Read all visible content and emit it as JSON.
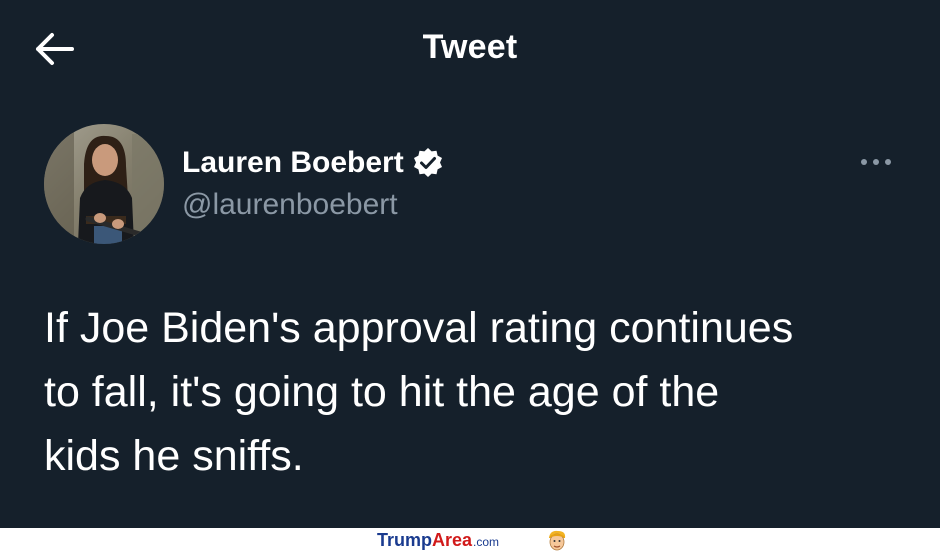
{
  "header": {
    "back_icon": "arrow-left-icon",
    "title": "Tweet"
  },
  "tweet": {
    "author": {
      "display_name": "Lauren Boebert",
      "verified": true,
      "verified_icon": "verified-badge-icon",
      "handle": "@laurenboebert"
    },
    "more_icon": "more-options-icon",
    "text": "If Joe Biden's approval rating continues\nto fall, it's going to hit the age of the\nkids he sniffs."
  },
  "watermark": {
    "brand_part1": "Trump",
    "brand_part2": "Area",
    "brand_suffix": ".com",
    "mascot_icon": "cartoon-face-icon"
  },
  "colors": {
    "background": "#15202b",
    "text_primary": "#ffffff",
    "text_secondary": "#8b98a5",
    "verified_badge": "#ffffff",
    "brand_blue": "#1a3b8f",
    "brand_red": "#d11a1a"
  }
}
